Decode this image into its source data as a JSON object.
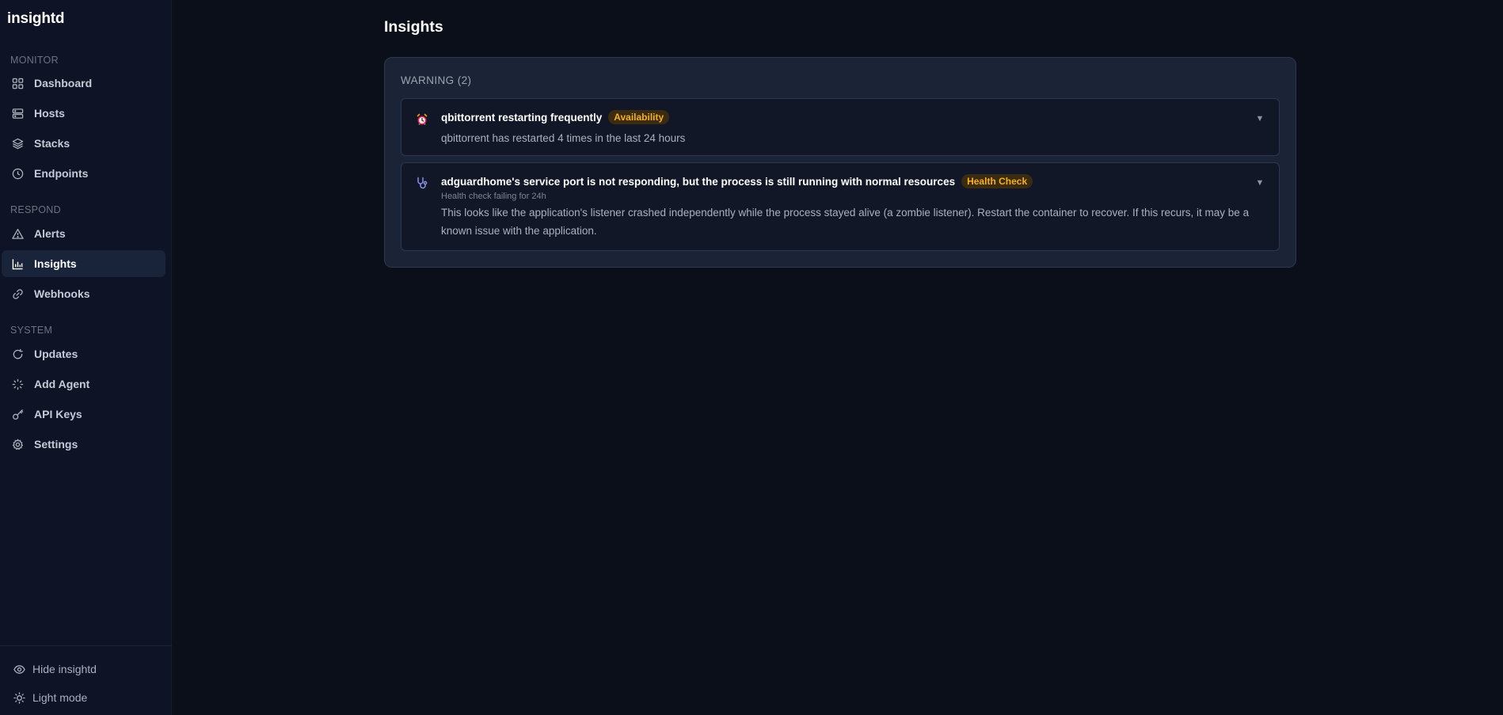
{
  "app": {
    "name": "insightd"
  },
  "sidebar": {
    "sections": [
      {
        "label": "MONITOR"
      },
      {
        "label": "RESPOND"
      },
      {
        "label": "SYSTEM"
      }
    ],
    "items": [
      {
        "label": "Dashboard",
        "icon": "grid-icon"
      },
      {
        "label": "Hosts",
        "icon": "server-icon"
      },
      {
        "label": "Stacks",
        "icon": "layers-icon"
      },
      {
        "label": "Endpoints",
        "icon": "clock-icon"
      },
      {
        "label": "Alerts",
        "icon": "warning-triangle-icon"
      },
      {
        "label": "Insights",
        "icon": "bar-chart-icon",
        "active": true
      },
      {
        "label": "Webhooks",
        "icon": "link-icon"
      },
      {
        "label": "Updates",
        "icon": "refresh-icon"
      },
      {
        "label": "Add Agent",
        "icon": "loader-icon"
      },
      {
        "label": "API Keys",
        "icon": "key-icon"
      },
      {
        "label": "Settings",
        "icon": "gear-icon"
      }
    ],
    "footer": [
      {
        "label": "Hide insightd",
        "icon": "eye-icon"
      },
      {
        "label": "Light mode",
        "icon": "sun-icon"
      }
    ]
  },
  "main": {
    "title": "Insights",
    "group": {
      "header": "WARNING (2)",
      "cards": [
        {
          "icon": "alarm-clock-icon",
          "title": "qbittorrent restarting frequently",
          "badge": "Availability",
          "text": "qbittorrent has restarted 4 times in the last 24 hours"
        },
        {
          "icon": "stethoscope-icon",
          "title": "adguardhome's service port is not responding, but the process is still running with normal resources",
          "badge": "Health Check",
          "subtitle": "Health check failing for 24h",
          "text": "This looks like the application's listener crashed independently while the process stayed alive (a zombie listener). Restart the container to recover. If this recurs, it may be a known issue with the application."
        }
      ]
    }
  },
  "colors": {
    "background": "#0b0f19",
    "sidebar": "#0e1425",
    "panel": "#1b2436",
    "badge_text": "#f5b022",
    "badge_bg": "#3b2b10"
  }
}
